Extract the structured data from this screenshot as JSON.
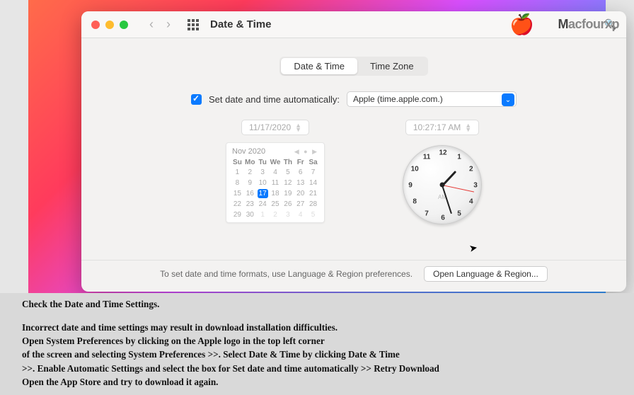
{
  "window": {
    "title": "Date & Time",
    "brand_m": "M",
    "brand_rest": "acfourxp",
    "search_placeholder": "Search"
  },
  "tabs": {
    "datetime": "Date & Time",
    "timezone": "Time Zone"
  },
  "auto": {
    "label": "Set date and time automatically:",
    "server": "Apple (time.apple.com.)"
  },
  "date_field": "11/17/2020",
  "time_field": "10:27:17 AM",
  "calendar": {
    "month": "Nov 2020",
    "dows": [
      "Su",
      "Mo",
      "Tu",
      "We",
      "Th",
      "Fr",
      "Sa"
    ],
    "rows": [
      [
        {
          "d": "1"
        },
        {
          "d": "2"
        },
        {
          "d": "3"
        },
        {
          "d": "4"
        },
        {
          "d": "5"
        },
        {
          "d": "6"
        },
        {
          "d": "7"
        }
      ],
      [
        {
          "d": "8"
        },
        {
          "d": "9"
        },
        {
          "d": "10"
        },
        {
          "d": "11"
        },
        {
          "d": "12"
        },
        {
          "d": "13"
        },
        {
          "d": "14"
        }
      ],
      [
        {
          "d": "15"
        },
        {
          "d": "16"
        },
        {
          "d": "17",
          "sel": true
        },
        {
          "d": "18"
        },
        {
          "d": "19"
        },
        {
          "d": "20"
        },
        {
          "d": "21"
        }
      ],
      [
        {
          "d": "22"
        },
        {
          "d": "23"
        },
        {
          "d": "24"
        },
        {
          "d": "25"
        },
        {
          "d": "26"
        },
        {
          "d": "27"
        },
        {
          "d": "28"
        }
      ],
      [
        {
          "d": "29"
        },
        {
          "d": "30"
        },
        {
          "d": "1",
          "other": true
        },
        {
          "d": "2",
          "other": true
        },
        {
          "d": "3",
          "other": true
        },
        {
          "d": "4",
          "other": true
        },
        {
          "d": "5",
          "other": true
        }
      ]
    ]
  },
  "clock": {
    "numbers": [
      "12",
      "1",
      "2",
      "3",
      "4",
      "5",
      "6",
      "7",
      "8",
      "9",
      "10",
      "11"
    ],
    "ampm": "AM",
    "hour_angle": -47,
    "min_angle": 72,
    "sec_angle": 12
  },
  "footer": {
    "text": "To set date and time formats, use Language & Region preferences.",
    "button": "Open Language & Region..."
  },
  "instructions": {
    "l1": "Check the Date and Time Settings.",
    "l2": "Incorrect date and time settings may result in download installation difficulties.",
    "l3": "Open System Preferences by clicking on the Apple logo in the top left corner",
    "l4": "of the screen and selecting System Preferences >>. Select Date & Time by clicking Date & Time",
    "l5": ">>. Enable Automatic Settings and select the box for Set date and time automatically >> Retry Download",
    "l6": "Open the App Store and try to download it again."
  }
}
